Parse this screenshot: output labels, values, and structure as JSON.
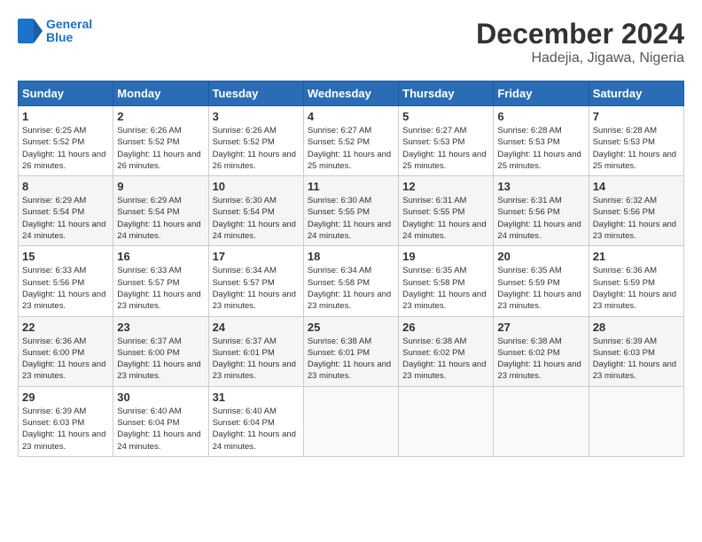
{
  "header": {
    "logo_line1": "General",
    "logo_line2": "Blue",
    "month_title": "December 2024",
    "location": "Hadejia, Jigawa, Nigeria"
  },
  "weekdays": [
    "Sunday",
    "Monday",
    "Tuesday",
    "Wednesday",
    "Thursday",
    "Friday",
    "Saturday"
  ],
  "weeks": [
    [
      {
        "day": "1",
        "sunrise": "6:25 AM",
        "sunset": "5:52 PM",
        "daylight": "11 hours and 26 minutes."
      },
      {
        "day": "2",
        "sunrise": "6:26 AM",
        "sunset": "5:52 PM",
        "daylight": "11 hours and 26 minutes."
      },
      {
        "day": "3",
        "sunrise": "6:26 AM",
        "sunset": "5:52 PM",
        "daylight": "11 hours and 26 minutes."
      },
      {
        "day": "4",
        "sunrise": "6:27 AM",
        "sunset": "5:52 PM",
        "daylight": "11 hours and 25 minutes."
      },
      {
        "day": "5",
        "sunrise": "6:27 AM",
        "sunset": "5:53 PM",
        "daylight": "11 hours and 25 minutes."
      },
      {
        "day": "6",
        "sunrise": "6:28 AM",
        "sunset": "5:53 PM",
        "daylight": "11 hours and 25 minutes."
      },
      {
        "day": "7",
        "sunrise": "6:28 AM",
        "sunset": "5:53 PM",
        "daylight": "11 hours and 25 minutes."
      }
    ],
    [
      {
        "day": "8",
        "sunrise": "6:29 AM",
        "sunset": "5:54 PM",
        "daylight": "11 hours and 24 minutes."
      },
      {
        "day": "9",
        "sunrise": "6:29 AM",
        "sunset": "5:54 PM",
        "daylight": "11 hours and 24 minutes."
      },
      {
        "day": "10",
        "sunrise": "6:30 AM",
        "sunset": "5:54 PM",
        "daylight": "11 hours and 24 minutes."
      },
      {
        "day": "11",
        "sunrise": "6:30 AM",
        "sunset": "5:55 PM",
        "daylight": "11 hours and 24 minutes."
      },
      {
        "day": "12",
        "sunrise": "6:31 AM",
        "sunset": "5:55 PM",
        "daylight": "11 hours and 24 minutes."
      },
      {
        "day": "13",
        "sunrise": "6:31 AM",
        "sunset": "5:56 PM",
        "daylight": "11 hours and 24 minutes."
      },
      {
        "day": "14",
        "sunrise": "6:32 AM",
        "sunset": "5:56 PM",
        "daylight": "11 hours and 23 minutes."
      }
    ],
    [
      {
        "day": "15",
        "sunrise": "6:33 AM",
        "sunset": "5:56 PM",
        "daylight": "11 hours and 23 minutes."
      },
      {
        "day": "16",
        "sunrise": "6:33 AM",
        "sunset": "5:57 PM",
        "daylight": "11 hours and 23 minutes."
      },
      {
        "day": "17",
        "sunrise": "6:34 AM",
        "sunset": "5:57 PM",
        "daylight": "11 hours and 23 minutes."
      },
      {
        "day": "18",
        "sunrise": "6:34 AM",
        "sunset": "5:58 PM",
        "daylight": "11 hours and 23 minutes."
      },
      {
        "day": "19",
        "sunrise": "6:35 AM",
        "sunset": "5:58 PM",
        "daylight": "11 hours and 23 minutes."
      },
      {
        "day": "20",
        "sunrise": "6:35 AM",
        "sunset": "5:59 PM",
        "daylight": "11 hours and 23 minutes."
      },
      {
        "day": "21",
        "sunrise": "6:36 AM",
        "sunset": "5:59 PM",
        "daylight": "11 hours and 23 minutes."
      }
    ],
    [
      {
        "day": "22",
        "sunrise": "6:36 AM",
        "sunset": "6:00 PM",
        "daylight": "11 hours and 23 minutes."
      },
      {
        "day": "23",
        "sunrise": "6:37 AM",
        "sunset": "6:00 PM",
        "daylight": "11 hours and 23 minutes."
      },
      {
        "day": "24",
        "sunrise": "6:37 AM",
        "sunset": "6:01 PM",
        "daylight": "11 hours and 23 minutes."
      },
      {
        "day": "25",
        "sunrise": "6:38 AM",
        "sunset": "6:01 PM",
        "daylight": "11 hours and 23 minutes."
      },
      {
        "day": "26",
        "sunrise": "6:38 AM",
        "sunset": "6:02 PM",
        "daylight": "11 hours and 23 minutes."
      },
      {
        "day": "27",
        "sunrise": "6:38 AM",
        "sunset": "6:02 PM",
        "daylight": "11 hours and 23 minutes."
      },
      {
        "day": "28",
        "sunrise": "6:39 AM",
        "sunset": "6:03 PM",
        "daylight": "11 hours and 23 minutes."
      }
    ],
    [
      {
        "day": "29",
        "sunrise": "6:39 AM",
        "sunset": "6:03 PM",
        "daylight": "11 hours and 23 minutes."
      },
      {
        "day": "30",
        "sunrise": "6:40 AM",
        "sunset": "6:04 PM",
        "daylight": "11 hours and 24 minutes."
      },
      {
        "day": "31",
        "sunrise": "6:40 AM",
        "sunset": "6:04 PM",
        "daylight": "11 hours and 24 minutes."
      },
      null,
      null,
      null,
      null
    ]
  ]
}
